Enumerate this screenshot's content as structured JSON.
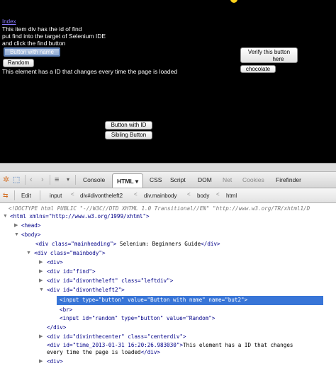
{
  "page": {
    "index_link": "Index",
    "intro_lines": [
      "This item div has the id of find",
      "put find into the target of Selenium IDE",
      "and click the find button"
    ],
    "button_with_name": "Button with name",
    "random_button": "Random",
    "changing_id_text": "This element has a ID that changes every time the page is loaded",
    "verify_button_line1": "Verify this button",
    "verify_button_line2": "here",
    "chocolate_button": "chocolate",
    "button_with_id": "Button with ID",
    "sibling_button": "Sibling Button"
  },
  "firebug": {
    "tabs": [
      "Console",
      "HTML",
      "CSS",
      "Script",
      "DOM",
      "Net",
      "Cookies",
      "Firefinder"
    ],
    "active_tab": "HTML",
    "active_tab_arrow": "▾",
    "edit_label": "Edit",
    "breadcrumbs": [
      "input",
      "div#divontheleft2",
      "div.mainbody",
      "body",
      "html"
    ],
    "tree": {
      "doctype": "<!DOCTYPE html PUBLIC \"-//W3C//DTD XHTML 1.0 Transitional//EN\" \"http://www.w3.org/TR/xhtml1/D",
      "html_open": "<html xmlns=\"http://www.w3.org/1999/xhtml\">",
      "head": "<head>",
      "body": "<body>",
      "mainheading_pre": "<div class=\"mainheading\">",
      "mainheading_text": "Selenium: Beginners Guide",
      "mainheading_post": "</div>",
      "mainbody": "<div class=\"mainbody\">",
      "div_empty": "<div>",
      "div_find": "<div id=\"find\">",
      "div_leftdiv": "<div id=\"divontheleft\" class=\"leftdiv\">",
      "div_left2": "<div id=\"divontheleft2\">",
      "input_but2": "<input type=\"button\" value=\"Button with name\" name=\"but2\">",
      "br": "<br>",
      "input_random": "<input id=\"random\" type=\"button\" value=\"Random\">",
      "div_close": "</div>",
      "div_center": "<div id=\"divinthecenter\" class=\"centerdiv\">",
      "div_time": "<div id=\"time_2013-01-31 16:20:26.983030\">",
      "time_text_1": "This element has a ID that changes",
      "time_text_2": "every time the page is loaded",
      "time_close": "</div>",
      "last_div": "<div>"
    }
  },
  "colors": {
    "link": "#8b7bff",
    "selection": "#3875d7",
    "tag": "#000088",
    "attribute": "#881280",
    "value": "#b22222"
  }
}
